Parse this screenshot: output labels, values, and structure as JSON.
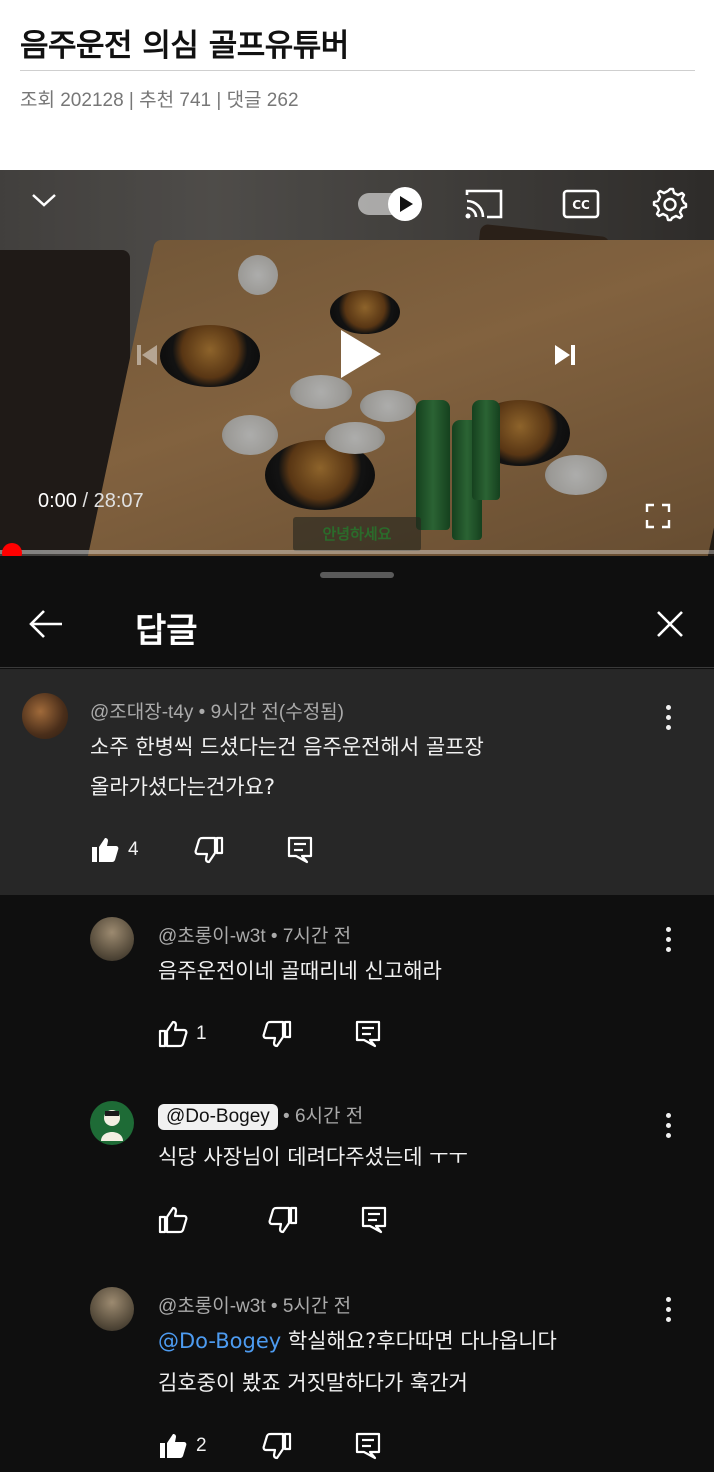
{
  "post": {
    "title": "음주운전 의심 골프유튜버",
    "stats": "조회 202128 | 추천 741 | 댓글 262"
  },
  "player": {
    "current_time": "0:00",
    "duration": " / 28:07",
    "subtitle_text": "안녕하세요",
    "progress": 0.0,
    "icons": [
      "chevron-down-icon",
      "autoplay-toggle-icon",
      "cast-icon",
      "closed-captions-icon",
      "settings-icon",
      "previous-icon",
      "play-icon",
      "next-icon",
      "fullscreen-icon"
    ],
    "accent_color": "#ff0000"
  },
  "replies_panel": {
    "title": "답글",
    "parent_comment": {
      "author_meta": "@조대장-t4y • 9시간 전(수정됨)",
      "lines": [
        "소주 한병씩 드셨다는건 음주운전해서 골프장",
        "올라가셨다는건가요?"
      ],
      "likes": "4"
    },
    "replies": [
      {
        "author_meta": "@초롱이-w3t • 7시간 전",
        "lines": [
          "음주운전이네 골때리네 신고해라"
        ],
        "likes": "1"
      },
      {
        "author_chip": "@Do-Bogey",
        "time": " • 6시간 전",
        "lines": [
          "식당 사장님이 데려다주셨는데 ㅜㅜ"
        ],
        "likes": ""
      },
      {
        "author_meta": "@초롱이-w3t • 5시간 전",
        "mention": "@Do-Bogey",
        "lines": [
          " 학실해요?후다따면 다나옵니다",
          "김호중이 봤죠 거짓말하다가 훅간거"
        ],
        "likes": "2"
      }
    ]
  }
}
